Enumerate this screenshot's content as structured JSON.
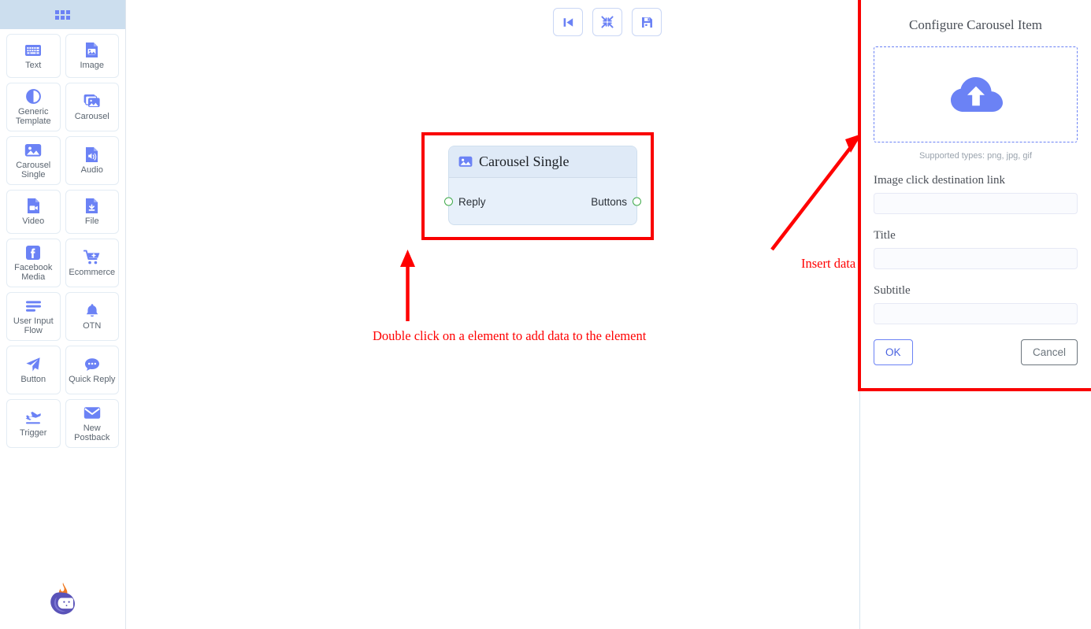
{
  "sidebar": {
    "header_icon": "grip-apps-icon",
    "items": [
      {
        "label": "Text",
        "icon": "keyboard-icon"
      },
      {
        "label": "Image",
        "icon": "file-image-icon"
      },
      {
        "label": "Generic Template",
        "icon": "half-circle-icon"
      },
      {
        "label": "Carousel",
        "icon": "images-stack-icon"
      },
      {
        "label": "Carousel Single",
        "icon": "image-icon"
      },
      {
        "label": "Audio",
        "icon": "file-audio-icon"
      },
      {
        "label": "Video",
        "icon": "file-video-icon"
      },
      {
        "label": "File",
        "icon": "file-download-icon"
      },
      {
        "label": "Facebook Media",
        "icon": "facebook-icon"
      },
      {
        "label": "Ecommerce",
        "icon": "shopping-cart-plus-icon"
      },
      {
        "label": "User Input Flow",
        "icon": "bars-icon"
      },
      {
        "label": "OTN",
        "icon": "bell-icon"
      },
      {
        "label": "Button",
        "icon": "paper-plane-icon"
      },
      {
        "label": "Quick Reply",
        "icon": "comment-dots-icon"
      },
      {
        "label": "Trigger",
        "icon": "plane-icon"
      },
      {
        "label": "New Postback",
        "icon": "envelope-icon"
      }
    ],
    "logo": "flame-bot-logo"
  },
  "toolbar": {
    "buttons": [
      {
        "name": "step-backward-button",
        "icon": "step-backward-icon"
      },
      {
        "name": "fit-to-screen-button",
        "icon": "compress-arrows-icon"
      },
      {
        "name": "save-button",
        "icon": "floppy-save-icon"
      }
    ]
  },
  "canvas": {
    "node": {
      "title": "Carousel Single",
      "icon": "image-icon",
      "input_port_label": "Reply",
      "output_port_label": "Buttons"
    },
    "annotations": [
      {
        "text": "Double click on a element to add data to the element",
        "arrow": "up-arrow"
      },
      {
        "text": "Insert data for the element",
        "arrow": "diagonal-up-right-arrow"
      }
    ],
    "highlight_color": "#f90000"
  },
  "panel": {
    "title": "Configure Carousel Item",
    "dropzone": {
      "icon": "cloud-upload-icon",
      "supported_types": "Supported types: png, jpg, gif"
    },
    "fields": [
      {
        "label": "Image click destination link",
        "value": "",
        "placeholder": "",
        "name": "image-link-field"
      },
      {
        "label": "Title",
        "value": "",
        "placeholder": "",
        "name": "title-field"
      },
      {
        "label": "Subtitle",
        "value": "",
        "placeholder": "",
        "name": "subtitle-field"
      }
    ],
    "ok_label": "OK",
    "cancel_label": "Cancel"
  },
  "colors": {
    "accent_blue": "#6b82f5",
    "annotation_red": "#ff0000",
    "port_green": "#3faa4a",
    "node_body": "#e7f0fa",
    "node_header": "#dfeaf7",
    "sidebar_header": "#ccdeee"
  }
}
